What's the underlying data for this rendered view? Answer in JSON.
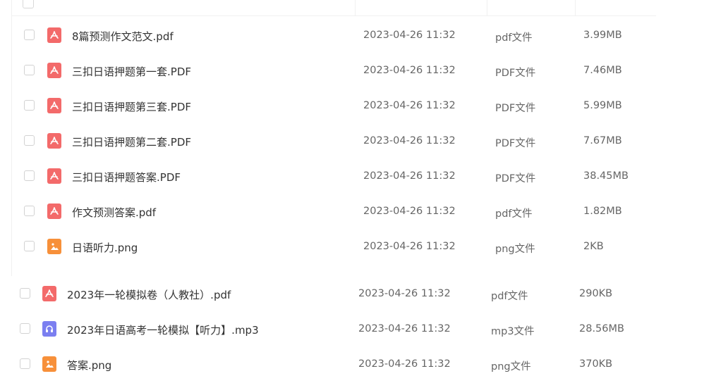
{
  "folder_files": [
    {
      "name": "8篇预测作文范文.pdf",
      "date": "2023-04-26 11:32",
      "type": "pdf文件",
      "size": "3.99MB",
      "icon": "pdf-icon"
    },
    {
      "name": "三扣日语押题第一套.PDF",
      "date": "2023-04-26 11:32",
      "type": "PDF文件",
      "size": "7.46MB",
      "icon": "pdf-icon"
    },
    {
      "name": "三扣日语押题第三套.PDF",
      "date": "2023-04-26 11:32",
      "type": "PDF文件",
      "size": "5.99MB",
      "icon": "pdf-icon"
    },
    {
      "name": "三扣日语押题第二套.PDF",
      "date": "2023-04-26 11:32",
      "type": "PDF文件",
      "size": "7.67MB",
      "icon": "pdf-icon"
    },
    {
      "name": "三扣日语押题答案.PDF",
      "date": "2023-04-26 11:32",
      "type": "PDF文件",
      "size": "38.45MB",
      "icon": "pdf-icon"
    },
    {
      "name": "作文预测答案.pdf",
      "date": "2023-04-26 11:32",
      "type": "pdf文件",
      "size": "1.82MB",
      "icon": "pdf-icon"
    },
    {
      "name": "日语听力.png",
      "date": "2023-04-26 11:32",
      "type": "png文件",
      "size": "2KB",
      "icon": "image-icon"
    }
  ],
  "root_files": [
    {
      "name": "2023年一轮模拟卷（人教社）.pdf",
      "date": "2023-04-26 11:32",
      "type": "pdf文件",
      "size": "290KB",
      "icon": "pdf-icon"
    },
    {
      "name": "2023年日语高考一轮模拟【听力】.mp3",
      "date": "2023-04-26 11:32",
      "type": "mp3文件",
      "size": "28.56MB",
      "icon": "audio-icon"
    },
    {
      "name": "答案.png",
      "date": "2023-04-26 11:32",
      "type": "png文件",
      "size": "370KB",
      "icon": "image-icon"
    }
  ]
}
